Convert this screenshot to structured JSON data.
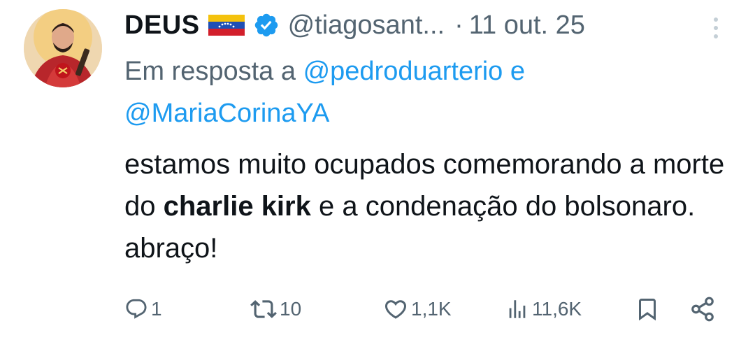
{
  "tweet": {
    "author": {
      "display_name": "DEUS",
      "handle": "@tiagosant...",
      "verified_icon": "verified-badge-icon",
      "flag_icon": "venezuela-flag-icon"
    },
    "separator": "·",
    "timestamp": "11 out. 25",
    "reply_prefix": "Em resposta a ",
    "reply_mention_1": "@pedroduarterio",
    "reply_conj": " e",
    "reply_mention_2": "@MariaCorinaYA",
    "text_part1": "estamos muito ocupados comemorando a morte do ",
    "text_bold": "charlie kirk",
    "text_part2": " e a condenação do bolsonaro. abraço!",
    "actions": {
      "replies": "1",
      "retweets": "10",
      "likes": "1,1K",
      "views": "11,6K"
    }
  },
  "colors": {
    "text": "#0f1419",
    "secondary": "#536471",
    "link": "#1d9bf0",
    "verified": "#1d9bf0"
  }
}
